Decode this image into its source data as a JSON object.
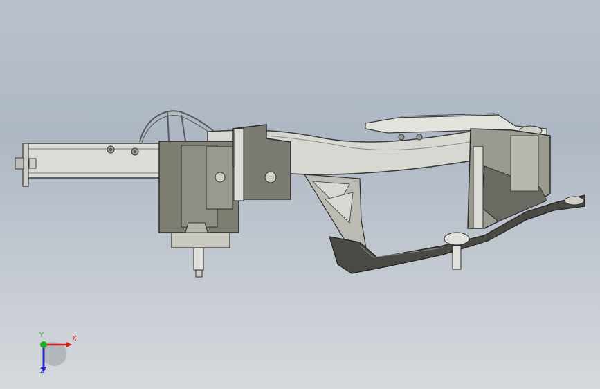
{
  "viewport": {
    "background_top": "#b8c1cc",
    "background_bottom": "#d6d9dd",
    "model": "frame-assembly"
  },
  "triad": {
    "x_label": "X",
    "y_label": "Y",
    "z_label": "Z",
    "x_color": "#d42020",
    "y_color": "#20b020",
    "z_color": "#2a2ad0"
  }
}
